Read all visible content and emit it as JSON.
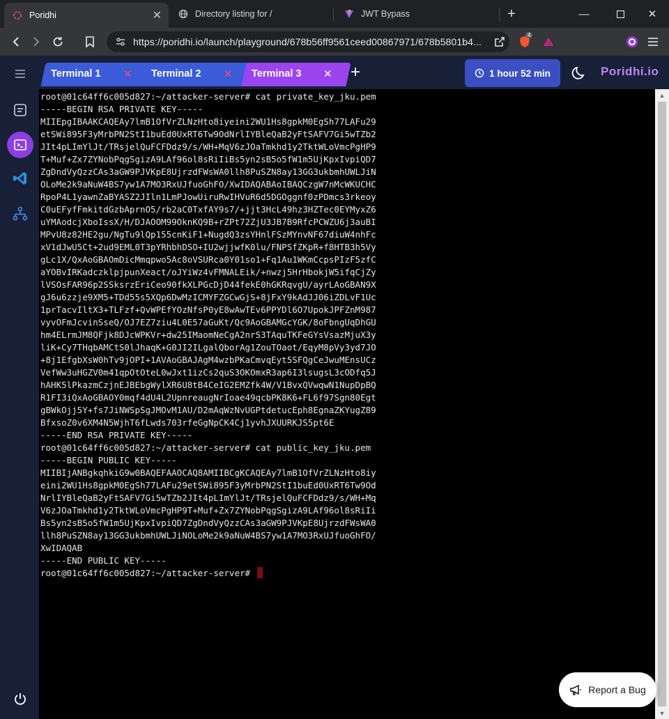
{
  "browser": {
    "tabs": [
      {
        "title": "Poridhi",
        "active": true
      },
      {
        "title": "Directory listing for /",
        "active": false
      },
      {
        "title": "JWT Bypass",
        "active": false
      }
    ],
    "url": "https://poridhi.io/launch/playground/678b56ff9561ceed00867971/678b5801b4...",
    "extension_badge": "4"
  },
  "app": {
    "brand": "Poridhi.io",
    "terminal_tabs": [
      {
        "label": "Terminal 1"
      },
      {
        "label": "Terminal 2"
      },
      {
        "label": "Terminal 3",
        "active": true
      }
    ],
    "timer": "1 hour 52 min",
    "report_bug": "Report a Bug",
    "colors": {
      "sidebar": "#172036",
      "tab": "#3b5bd9",
      "active_tab": "#9b45f0",
      "timer": "#3b4fc2",
      "close": "#ff4d6a"
    }
  },
  "terminal": {
    "lines": [
      "root@01c64ff6c005d827:~/attacker-server# cat private_key_jku.pem",
      "-----BEGIN RSA PRIVATE KEY-----",
      "MIIEpgIBAAKCAQEAy7lmB1OfVrZLNzHto8iyeini2WU1Hs8gpkM0EgSh77LAFu29",
      "etSWi895F3yMrbPN2StI1buEd0UxRT6Tw9OdNrlIYBleQaB2yFtSAFV7Gi5wTZb2",
      "JIt4pLImYlJt/TRsjelQuFCFDdz9/s/WH+MqV6zJOaTmkhd1y2TktWLoVmcPgHP9",
      "T+Muf+Zx7ZYNobPqgSgizA9LAf96ol8sRiIiBs5yn2sB5o5fW1m5UjKpxIvpiQD7",
      "ZgDndVyQzzCAs3aGW9PJVKpE8UjrzdFWsWA0llh8PuSZN8ay13GG3ukbmhUWLJiN",
      "OLoMe2k9aNuW4BS7yw1A7MO3RxUJfuoGhFO/XwIDAQABAoIBAQCzgW7nMcWKUCHC",
      "RpoP4L1yawnZaBYASZ2JIln1LmPJowUiruRwIHVuR6d5DGOggnf0zPDmcs3rkeoy",
      "C0uEFyfFmkitdGzbAprnO5/rb2aC0TxfAY9s7/+jjt3HcL49hz3HZTec0EYMyxZ6",
      "uYMAodcjXboIssX/H/DJAOOM99OknKQ9B+rZPt72ZjU3JB7B9RfcPCWZU6j3auBI",
      "MPvU8z82HE2gu/NgTu9lQp155cnKiF1+NugdQ3zsYHnlFSzMYnvNF67diuW4nhFc",
      "xV1dJwU5Ct+2ud9EML0T3pYRhbhDSO+IU2wjjwfK0lu/FNPSfZKpR+f8HTB3h5Vy",
      "gLc1X/QxAoGBAOmDicMmqpwo5Ac8oVSURca0Y01so1+Fq1Au1WKmCcpsPIzF5zfC",
      "aYOBvIRKadczklpjpunXeact/oJYiWz4vFMNALEik/+nwzj5HrHbokjW5ifqCjZy",
      "lVSOsFAR96p2SSksrzEriCeo90fkXLPGcDjD44fekE0hGKRqvgU/ayrLAoGBAN9X",
      "gJ6u6zzje9XM5+TDd55s5XQp6DwMzICMYFZGCwGjS+8jFxY9kAdJJ06iZDLvF1Uc",
      "1prTacvIltX3+TLFzf+QvWPEfYOzNfsP0yE8wAwTEv6PPYDl6O7UpokJPFZnM987",
      "vyvOFmJcvinSseQ/OJ7EZ7ziu4L0E57aGuKt/Qc9AoGBAMGcYGK/8oFbngUqDhGU",
      "hm4ELrmJM8QFjk8DJcWPKVr+dw25IMaomNeCgA2nrS3TAquTKFeGYsVsazMjuX3y",
      "liK+Cy7THqbAMCtS0lJhaqK+G0JI2ILgalQborAg1ZouTOaot/EqyM8pVy3yd7JO",
      "+8j1EfgbXsW0hTv9jOPI+1AVAoGBAJAgM4wzbPKaCmvqEyt5SFQgCeJwuMEnsUCz",
      "VefWw3uHGZV0m41qpOtOteL0wJxt1izCs2quS3OKOmxR3ap6I3lsugsL3cODfq5J",
      "hAHK5lPkazmCzjnEJBEbgWylXR6U8tB4CeIG2EMZfk4W/V1BvxQVwqwN1NupDpBQ",
      "R1FI3iQxAoGBAOY0mqf4dU4L2UpnreaugNrIoae49qcbPK8K6+FL6f97Sgn80Egt",
      "gBWkOjj5Y+fs7JiNWSpSgJMOvM1AU/D2mAqWzNvUGPtdetucEph8EgnaZKYugZ89",
      "BfxsoZ0v6XM4N5WjhT6fLwds703rfeGgNpCK4Cj1yvhJXUURKJS5pt6E",
      "-----END RSA PRIVATE KEY-----",
      "root@01c64ff6c005d827:~/attacker-server# cat public_key_jku.pem",
      "-----BEGIN PUBLIC KEY-----",
      "MIIBIjANBgkqhkiG9w0BAQEFAAOCAQ8AMIIBCgKCAQEAy7lmB1OfVrZLNzHto8iy",
      "eini2WU1Hs8gpkM0EgSh77LAFu29etSWi895F3yMrbPN2StI1buEd0UxRT6Tw9Od",
      "NrlIYBleQaB2yFtSAFV7Gi5wTZb2JIt4pLImYlJt/TRsjelQuFCFDdz9/s/WH+Mq",
      "V6zJOaTmkhd1y2TktWLoVmcPgHP9T+Muf+Zx7ZYNobPqgSgizA9LAf96ol8sRiIi",
      "Bs5yn2sB5o5fW1m5UjKpxIvpiQD7ZgDndVyQzzCAs3aGW9PJVKpE8UjrzdFWsWA0",
      "llh8PuSZN8ay13GG3ukbmhUWLJiNOLoMe2k9aNuW4BS7yw1A7MO3RxUJfuoGhFO/",
      "XwIDAQAB",
      "-----END PUBLIC KEY-----"
    ],
    "prompt": "root@01c64ff6c005d827:~/attacker-server#"
  }
}
